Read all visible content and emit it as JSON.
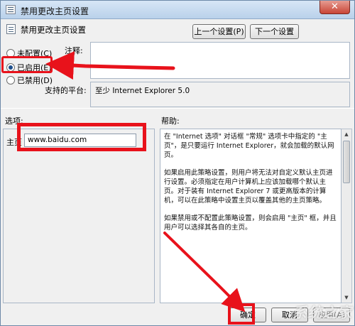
{
  "window": {
    "title": "禁用更改主页设置",
    "close_symbol": "✕"
  },
  "header": {
    "setting_title": "禁用更改主页设置",
    "prev_button": "上一个设置(P)",
    "next_button": "下一个设置(N)"
  },
  "state": {
    "options": [
      {
        "label": "未配置(C)",
        "checked": false
      },
      {
        "label": "已启用(E)",
        "checked": true
      },
      {
        "label": "已禁用(D)",
        "checked": false
      }
    ]
  },
  "comment": {
    "label": "注释:",
    "value": ""
  },
  "platform": {
    "label": "支持的平台:",
    "value": "至少 Internet Explorer 5.0"
  },
  "options_section": {
    "label": "选项:",
    "homepage_label": "主页",
    "homepage_value": "www.baidu.com"
  },
  "help_section": {
    "label": "帮助:",
    "paragraphs": [
      "在 \"Internet 选项\" 对话框 \"常规\" 选项卡中指定的 \"主页\"，是只要运行 Internet Explorer，就会加载的默认网页。",
      "如果启用此策略设置，则用户将无法对自定义默认主页进行设置。必须指定在用户计算机上应该加载哪个默认主页。对于装有 Internet Explorer 7 或更高版本的计算机，可以在此策略中设置主页以覆盖其他的主页策略。",
      "如果禁用或不配置此策略设置，则会启用 \"主页\" 框，并且用户可以选择其各自的主页。"
    ]
  },
  "footer": {
    "ok_button": "确定",
    "cancel_button": "取消",
    "apply_button": "应用(A)"
  },
  "watermark": "系统之家",
  "colors": {
    "annotation_red": "#e8121b",
    "titlebar": "#c7dbf0",
    "close_button": "#c94536"
  }
}
